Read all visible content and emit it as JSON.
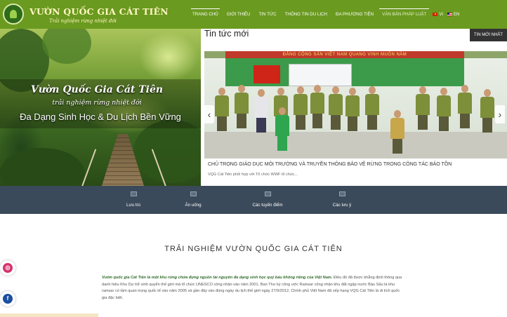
{
  "header": {
    "logo_title": "VƯỜN QUỐC GIA CÁT TIÊN",
    "logo_subtitle": "Trải nghiệm rừng nhiệt đới",
    "nav": [
      {
        "label": "TRANG CHỦ"
      },
      {
        "label": "GIỚI THIỆU"
      },
      {
        "label": "TIN TỨC"
      },
      {
        "label": "THÔNG TIN DU LỊCH"
      },
      {
        "label": "ĐA PHƯƠNG TIỆN"
      },
      {
        "label": "VĂN BẢN PHÁP LUẬT"
      }
    ],
    "lang_vi": "VI",
    "lang_en": "EN"
  },
  "hero": {
    "title": "Vườn Quốc Gia Cát Tiên",
    "subtitle": "trải nghiệm rừng nhiệt đới",
    "tagline": "Đa Dạng Sinh Học & Du Lịch Bền Vững"
  },
  "news": {
    "section_title": "Tin tức mới",
    "latest_button": "TIN MỚI NHẤT",
    "banner_text": "ĐẢNG CỘNG SẢN VIỆT NAM QUANG VINH MUÔN NĂM",
    "headline": "CHỦ TRỌNG GIÁO DỤC MÔI TRƯỜNG VÀ TRUYỀN THÔNG BẢO VỆ RỪNG TRONG CÔNG TÁC BẢO TỒN",
    "excerpt": "VQG Cát Tiên phối hợp với Tổ chức WWF tổ chức..."
  },
  "services": [
    {
      "label": "Lưu trú",
      "icon": "lodging-icon"
    },
    {
      "label": "Ăn uống",
      "icon": "dining-icon"
    },
    {
      "label": "Các tuyến điểm",
      "icon": "routes-icon"
    },
    {
      "label": "Các lưu ý",
      "icon": "notes-icon"
    }
  ],
  "intro": {
    "title": "TRẢI NGHIỆM VƯỜN QUỐC GIA CÁT TIÊN",
    "lead": "Vườn quốc gia Cát Tiên là một khu rừng chứa đựng nguồn tài nguyên đa dạng sinh học quý báu không riêng của Việt Nam.",
    "body": " Điều đó đã được khẳng định thông qua danh hiệu Khu Dự trữ sinh quyển thế giới mà tổ chức UNESCO công nhận vào năm 2001, Ban Thư ký công ước Ramsar công nhận khu đất ngập nước Bàu Sấu là khu ramsar có tầm quan trọng quốc tế vào năm 2005 và gần đây vào đúng ngày du lịch thế giới ngày 27/9/2012, Chính phủ Việt Nam đã xếp hạng VQG Cát Tiên là di tích quốc gia đặc biệt."
  },
  "social": {
    "instagram_icon": "instagram-icon",
    "facebook_icon": "facebook-icon"
  },
  "colors": {
    "header_bg": "#6a9a1f",
    "service_bar_bg": "#3b4a5a",
    "button_dark": "#333333"
  }
}
